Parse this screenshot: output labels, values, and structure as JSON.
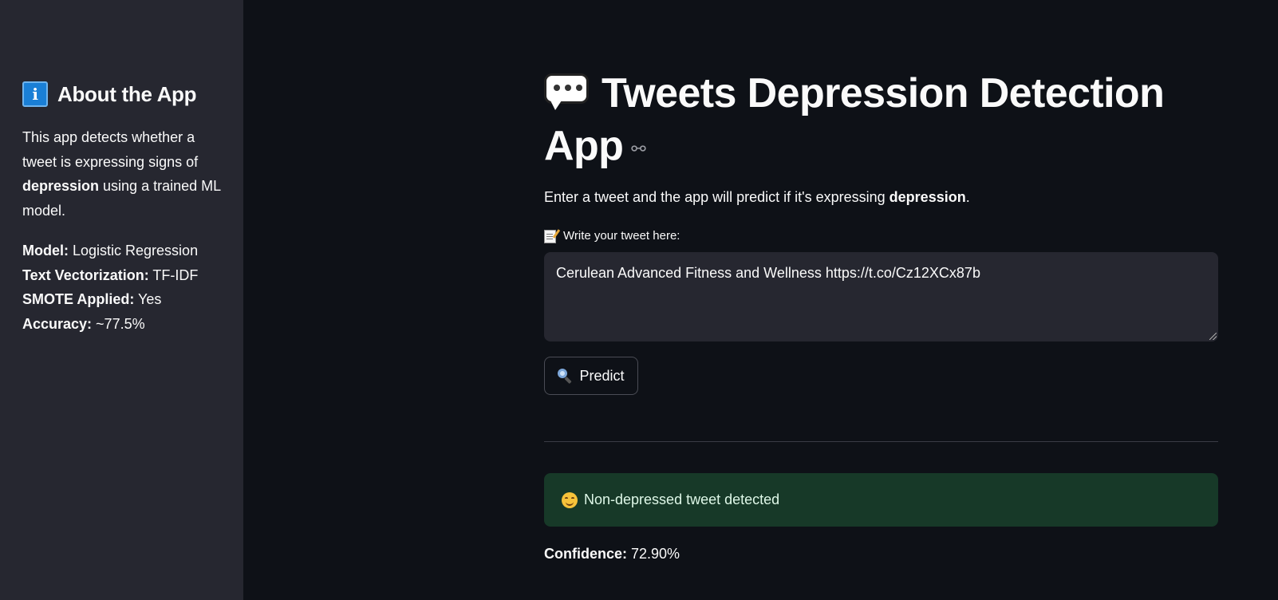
{
  "sidebar": {
    "heading_icon": "info-icon",
    "heading": "About the App",
    "description": {
      "part1": "This app detects whether a tweet is expressing signs of ",
      "bold": "depression",
      "part2": " using a trained ML model."
    },
    "specs": [
      {
        "label": "Model:",
        "value": " Logistic Regression"
      },
      {
        "label": "Text Vectorization:",
        "value": " TF-IDF"
      },
      {
        "label": "SMOTE Applied:",
        "value": " Yes"
      },
      {
        "label": "Accuracy:",
        "value": " ~77.5%"
      }
    ]
  },
  "main": {
    "title_icon": "speech-balloon-icon",
    "title": "Tweets Depression Detection App",
    "subtitle": {
      "part1": "Enter a tweet and the app will predict if it's expressing ",
      "bold": "depression",
      "part2": "."
    },
    "input_label": "Write your tweet here:",
    "input_label_icon": "memo-icon",
    "input_value": "Cerulean Advanced Fitness and Wellness https://t.co/Cz12XCx87b",
    "predict_button": "Predict",
    "predict_icon": "magnifier-icon",
    "result": {
      "icon": "smiling-face-icon",
      "text": "Non-depressed tweet detected",
      "color": "#173928"
    },
    "confidence": {
      "label": "Confidence:",
      "value": " 72.90%"
    }
  },
  "colors": {
    "background": "#0e1117",
    "sidebar": "#262730",
    "input_bg": "#262730",
    "success_bg": "#173928",
    "text": "#fafafa"
  }
}
